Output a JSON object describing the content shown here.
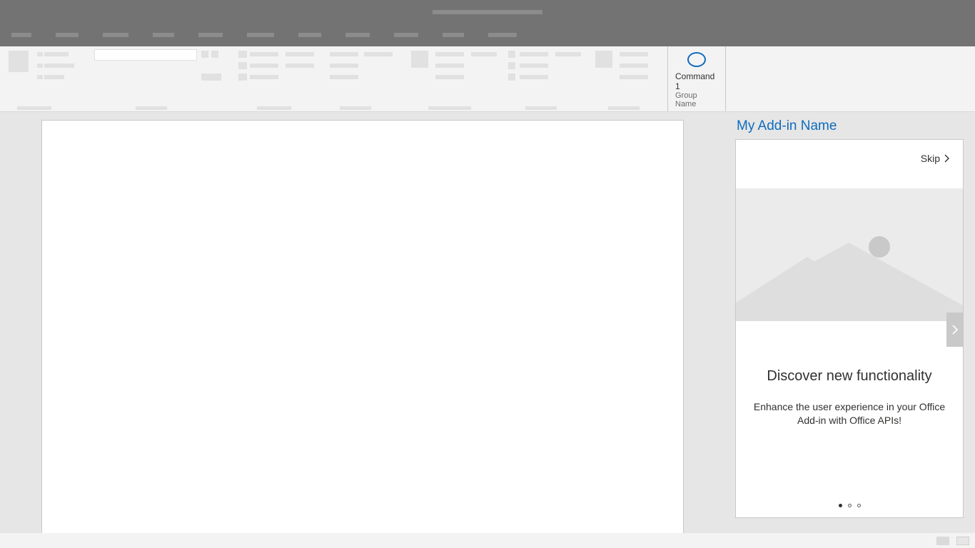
{
  "titlebar": {
    "placeholder": true
  },
  "tabs": [
    28,
    32,
    36,
    30,
    34,
    38,
    32,
    34,
    34,
    30,
    40
  ],
  "ribbon": {
    "command1_label": "Command 1",
    "group_label": "Group Name"
  },
  "taskpane": {
    "title": "My Add-in Name",
    "skip_label": "Skip",
    "card": {
      "heading": "Discover new functionality",
      "description": "Enhance the user experience in your Office Add-in with Office APIs!",
      "dot_count": 3,
      "active_dot": 0
    }
  }
}
